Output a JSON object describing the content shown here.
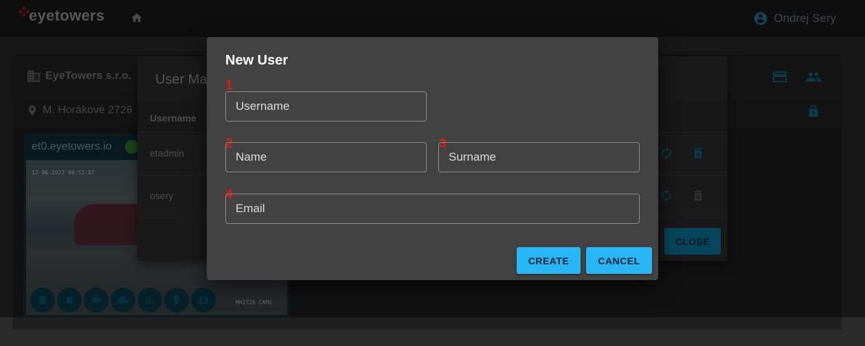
{
  "header": {
    "brand": "eyetowers",
    "user_name": "Ondrej Sery"
  },
  "dashboard": {
    "company": "EyeTowers s.r.o.",
    "address": "M. Horákové 2726",
    "camera": {
      "host": "et0.eyetowers.io",
      "timestamp": "12-06-2022 08:51:57",
      "cam_label": "MH2726 CAM1"
    }
  },
  "user_management": {
    "title": "User Ma",
    "column_username": "Username",
    "rows": [
      {
        "username": "etadmin"
      },
      {
        "username": "osery"
      }
    ],
    "close_label": "CLOSE"
  },
  "new_user": {
    "title": "New User",
    "username_placeholder": "Username",
    "name_placeholder": "Name",
    "surname_placeholder": "Surname",
    "email_placeholder": "Email",
    "markers": [
      "1",
      "2",
      "3",
      "4"
    ],
    "create_label": "CREATE",
    "cancel_label": "CANCEL"
  },
  "colors": {
    "accent": "#29b6f6",
    "marker": "#e8190d",
    "dialog_bg": "#424242"
  }
}
